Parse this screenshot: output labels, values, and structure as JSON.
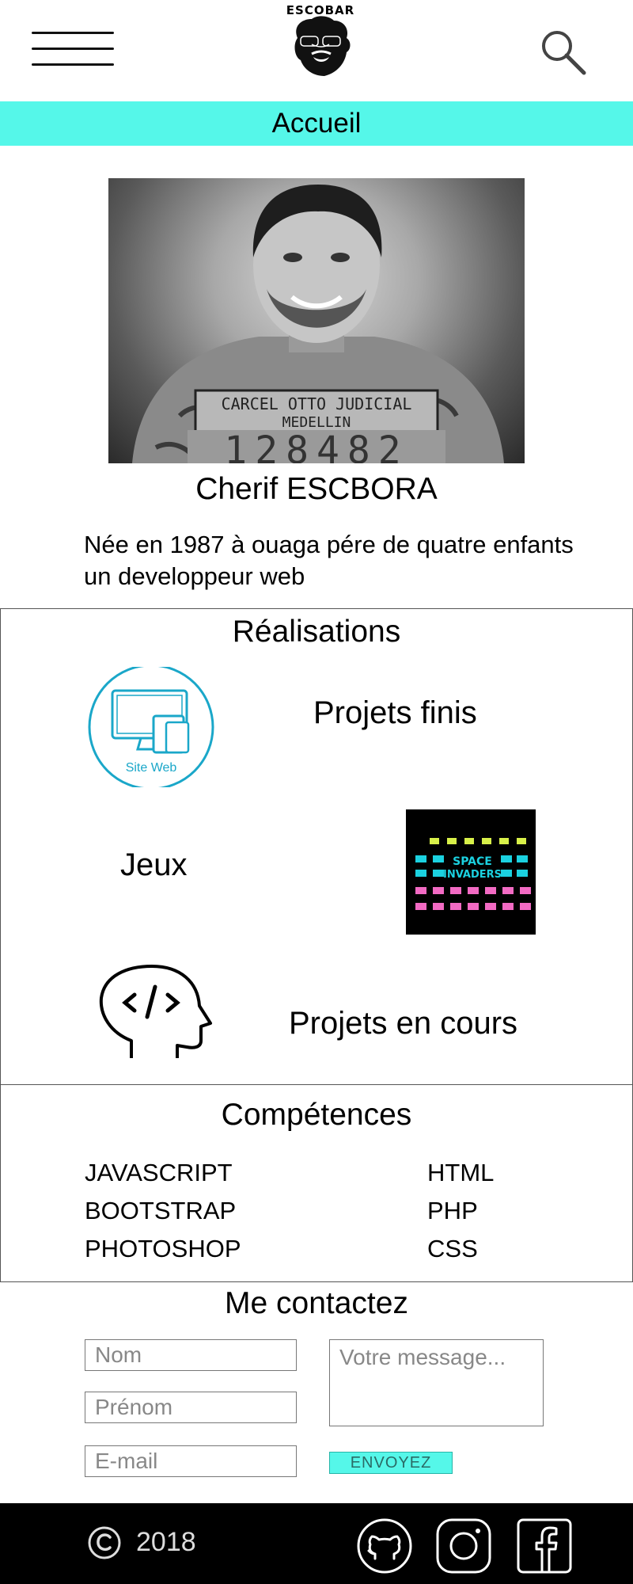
{
  "header": {
    "logo_text": "ESCOBAR",
    "menu_icon": "hamburger-menu-icon",
    "search_icon": "magnifier-icon"
  },
  "nav": {
    "active_label": "Accueil",
    "bar_color": "#55f7e9"
  },
  "profile": {
    "name": "Cherif ESCBORA",
    "bio": "Née en 1987 à ouaga pére de quatre enfants un developpeur web",
    "photo_sign_line1": "CARCEL OTTO JUDICIAL",
    "photo_sign_line2": "MEDELLIN",
    "photo_number": "128482"
  },
  "realisations": {
    "title": "Réalisations",
    "site_web_label": "Site Web",
    "items": [
      {
        "label": "Projets finis",
        "icon": "site-web-icon"
      },
      {
        "label": "Jeux",
        "icon": "space-invaders-image"
      },
      {
        "label": "Projets en cours",
        "icon": "coding-head-icon"
      }
    ],
    "game_text_line1": "SPACE",
    "game_text_line2": "INVADERS"
  },
  "competences": {
    "title": "Compétences",
    "left": [
      "JAVASCRIPT",
      "BOOTSTRAP",
      "PHOTOSHOP"
    ],
    "right": [
      "HTML",
      "PHP",
      "CSS"
    ]
  },
  "contact": {
    "title": "Me contactez",
    "nom_placeholder": "Nom",
    "prenom_placeholder": "Prénom",
    "email_placeholder": "E-mail",
    "message_placeholder": "Votre message...",
    "send_label": "ENVOYEZ"
  },
  "footer": {
    "year": "2018",
    "social_icons": [
      "github-icon",
      "instagram-icon",
      "facebook-icon"
    ]
  }
}
